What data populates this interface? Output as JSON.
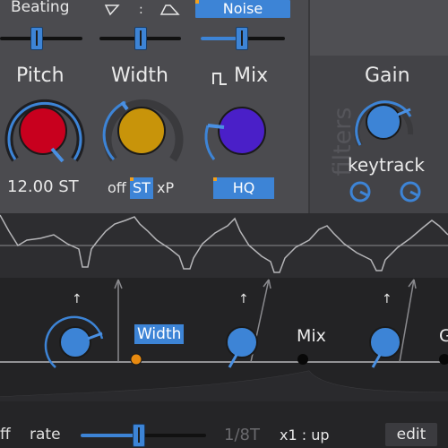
{
  "top": {
    "beating_label": "Beating",
    "shape_separator": ":",
    "noise_label": "Noise"
  },
  "knobs": {
    "pitch": {
      "label": "Pitch",
      "value_text": "12.00 ST",
      "color": "#c8001e"
    },
    "width": {
      "label": "Width",
      "color": "#c8940a"
    },
    "mix": {
      "label": "Mix",
      "icon": "square-wave-icon",
      "color": "#4a1fc8"
    },
    "gain": {
      "label": "Gain",
      "color": "#3d84d6"
    }
  },
  "width_mode": {
    "options": [
      "off",
      "ST",
      "xP"
    ],
    "selected": "ST"
  },
  "hq_label": "HQ",
  "filters_label": "filters",
  "keytrack_label": "keytrack",
  "modulation": {
    "width_label": "Width",
    "mix_label": "Mix",
    "cut_label": "G",
    "arrow": "↑"
  },
  "footer": {
    "off_label": "ff",
    "rate_label": "rate",
    "rate_value": "1/8T",
    "direction": "x1 : up",
    "edit_label": "edit"
  },
  "colors": {
    "accent": "#3d84d6",
    "orange": "#f0a020"
  }
}
